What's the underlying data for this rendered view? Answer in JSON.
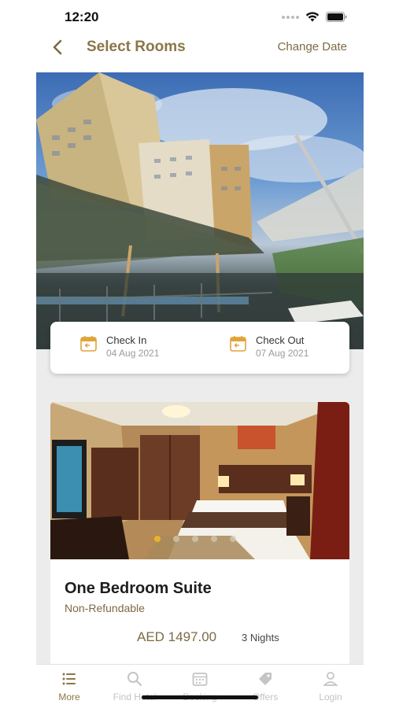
{
  "status_bar": {
    "time": "12:20"
  },
  "header": {
    "title": "Select Rooms",
    "change_date_label": "Change Date"
  },
  "dates": {
    "check_in": {
      "label": "Check In",
      "value": "04 Aug 2021"
    },
    "check_out": {
      "label": "Check Out",
      "value": "07 Aug 2021"
    }
  },
  "room": {
    "name": "One Bedroom Suite",
    "policy": "Non-Refundable",
    "price": "AED 1497.00",
    "nights": "3 Nights",
    "photo_count": 5,
    "active_photo": 1
  },
  "tabs": [
    {
      "label": "More",
      "icon": "menu-icon",
      "active": true
    },
    {
      "label": "Find Hotel",
      "icon": "search-icon",
      "active": false
    },
    {
      "label": "Booking",
      "icon": "calendar-icon",
      "active": false
    },
    {
      "label": "Offers",
      "icon": "tag-icon",
      "active": false
    },
    {
      "label": "Login",
      "icon": "user-icon",
      "active": false
    }
  ],
  "colors": {
    "accent": "#8b7648",
    "accent_text": "#7d6a44",
    "calendar_icon": "#e0a43a",
    "active_dot": "#e8b42a"
  }
}
